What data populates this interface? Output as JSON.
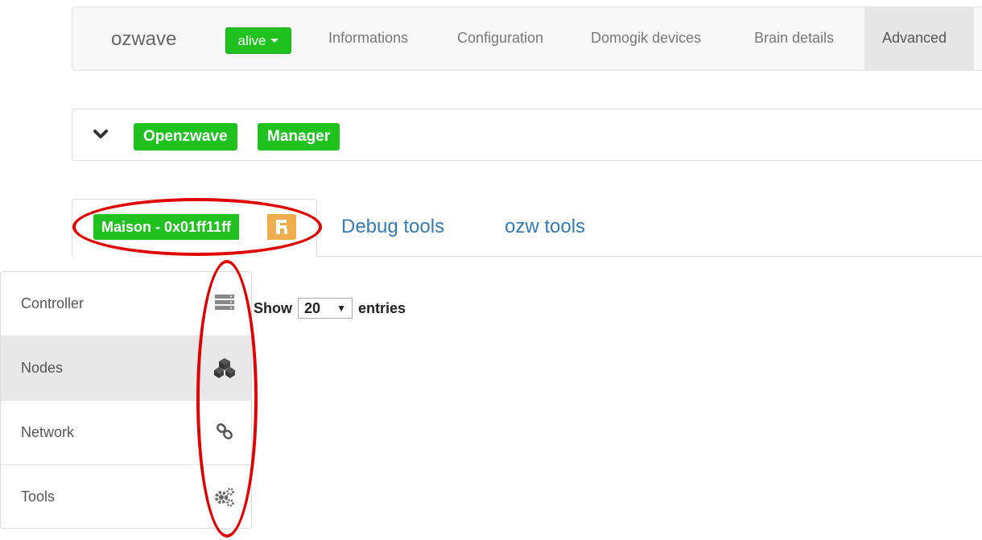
{
  "navbar": {
    "brand": "ozwave",
    "status_badge": "alive",
    "links": [
      "Informations",
      "Configuration",
      "Domogik devices",
      "Brain details"
    ],
    "active_link": "Advanced"
  },
  "panel": {
    "labels": [
      "Openzwave",
      "Manager"
    ]
  },
  "tabs": {
    "active_label": "Maison - 0x01ff11ff",
    "links": [
      "Debug tools",
      "ozw tools"
    ]
  },
  "sidebar": {
    "items": [
      {
        "label": "Controller",
        "icon": "server-icon",
        "active": false
      },
      {
        "label": "Nodes",
        "icon": "cubes-icon",
        "active": true
      },
      {
        "label": "Network",
        "icon": "link-icon",
        "active": false
      },
      {
        "label": "Tools",
        "icon": "cogs-icon",
        "active": false
      }
    ]
  },
  "table_controls": {
    "show_label": "Show",
    "entries_value": "20",
    "entries_label": "entries"
  },
  "colors": {
    "green": "#1fc21f",
    "orange": "#f0ad4e",
    "link_blue": "#337ab7",
    "annotation_red": "#e00000"
  }
}
